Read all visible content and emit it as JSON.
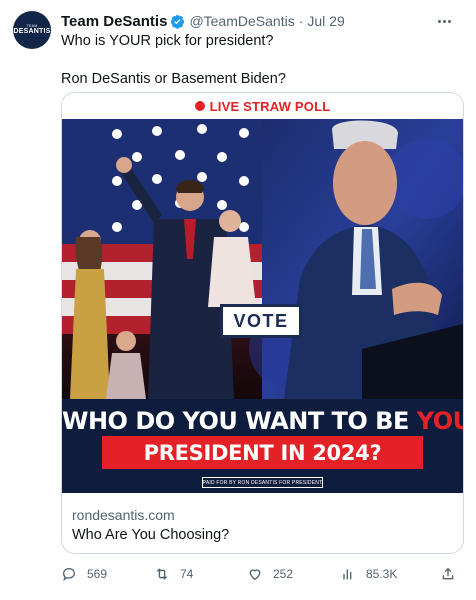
{
  "tweet": {
    "author": {
      "avatar_line1": "TEAM",
      "avatar_line2": "DESANTIS",
      "name": "Team DeSantis",
      "handle": "@TeamDeSantis",
      "separator": "·",
      "date": "Jul 29",
      "verified_icon": "verified-badge-icon",
      "verified_color": "#1d9bf0"
    },
    "text_line1": "Who is YOUR pick for president?",
    "text_line2": "Ron DeSantis or Basement Biden?"
  },
  "card": {
    "poll_label": "LIVE STRAW POLL",
    "vote_label": "VOTE",
    "headline_part1": "WHO DO YOU WANT TO BE ",
    "headline_highlight": "YOUR",
    "headline_line2": "PRESIDENT IN 2024?",
    "paid_for": "PAID FOR BY RON DESANTIS FOR PRESIDENT",
    "domain": "rondesantis.com",
    "title": "Who Are You Choosing?",
    "colors": {
      "navy": "#0e1c3d",
      "red": "#e32126"
    }
  },
  "actions": {
    "replies": "569",
    "retweets": "74",
    "likes": "252",
    "views": "85.3K",
    "icons": [
      "reply-icon",
      "retweet-icon",
      "like-icon",
      "views-icon",
      "share-icon"
    ]
  }
}
